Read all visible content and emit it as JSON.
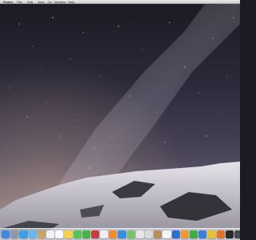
{
  "menubar": {
    "items": [
      {
        "label": "Finder",
        "name": "menu-finder"
      },
      {
        "label": "File",
        "name": "menu-file"
      },
      {
        "label": "Edit",
        "name": "menu-edit"
      },
      {
        "label": "View",
        "name": "menu-view"
      },
      {
        "label": "Go",
        "name": "menu-go"
      },
      {
        "label": "Window",
        "name": "menu-window"
      },
      {
        "label": "Help",
        "name": "menu-help"
      }
    ]
  },
  "desktop": {
    "wallpaper": "night-sky-mountain-milky-way"
  },
  "dock": {
    "apps": [
      {
        "icon": "finder-icon",
        "color": "#3f8ae6"
      },
      {
        "icon": "launchpad-icon",
        "color": "#8e9aa8"
      },
      {
        "icon": "safari-icon",
        "color": "#3aa0e8"
      },
      {
        "icon": "mail-icon",
        "color": "#6bb6ef"
      },
      {
        "icon": "contacts-icon",
        "color": "#c7a46a"
      },
      {
        "icon": "calendar-icon",
        "color": "#f2f2f2"
      },
      {
        "icon": "reminders-icon",
        "color": "#fafafa"
      },
      {
        "icon": "notes-icon",
        "color": "#f3d34a"
      },
      {
        "icon": "messages-icon",
        "color": "#57c35a"
      },
      {
        "icon": "facetime-icon",
        "color": "#4bb544"
      },
      {
        "icon": "photo-booth-icon",
        "color": "#c73d3d"
      },
      {
        "icon": "itunes-icon",
        "color": "#f0f0f0"
      },
      {
        "icon": "ibooks-icon",
        "color": "#f08c2a"
      },
      {
        "icon": "app-store-icon",
        "color": "#3a8ee0"
      },
      {
        "icon": "maps-icon",
        "color": "#7bc36b"
      },
      {
        "icon": "photos-icon",
        "color": "#e8e8e8"
      },
      {
        "icon": "game-center-icon",
        "color": "#d9d9d9"
      },
      {
        "icon": "preview-icon",
        "color": "#b98e5c"
      },
      {
        "icon": "textedit-icon",
        "color": "#f5f5f5"
      },
      {
        "icon": "keynote-icon",
        "color": "#2f6fd1"
      },
      {
        "icon": "pages-icon",
        "color": "#f29a2e"
      },
      {
        "icon": "numbers-icon",
        "color": "#3cae46"
      },
      {
        "icon": "xcode-icon",
        "color": "#3d7fd8"
      },
      {
        "icon": "chrome-icon",
        "color": "#e0c23a"
      },
      {
        "icon": "firefox-icon",
        "color": "#e2742a"
      },
      {
        "icon": "terminal-icon",
        "color": "#2b2b2b"
      },
      {
        "icon": "activity-monitor-icon",
        "color": "#444a50"
      },
      {
        "icon": "system-preferences-icon",
        "color": "#8d96a0"
      },
      {
        "icon": "disk-utility-icon",
        "color": "#9aa3ad"
      }
    ],
    "stack": [
      {
        "icon": "downloads-stack-icon",
        "color": "#6a9fd8"
      },
      {
        "icon": "documents-stack-icon",
        "color": "#b7c5d6"
      },
      {
        "icon": "trash-icon",
        "color": "#d7dbe0"
      }
    ]
  }
}
